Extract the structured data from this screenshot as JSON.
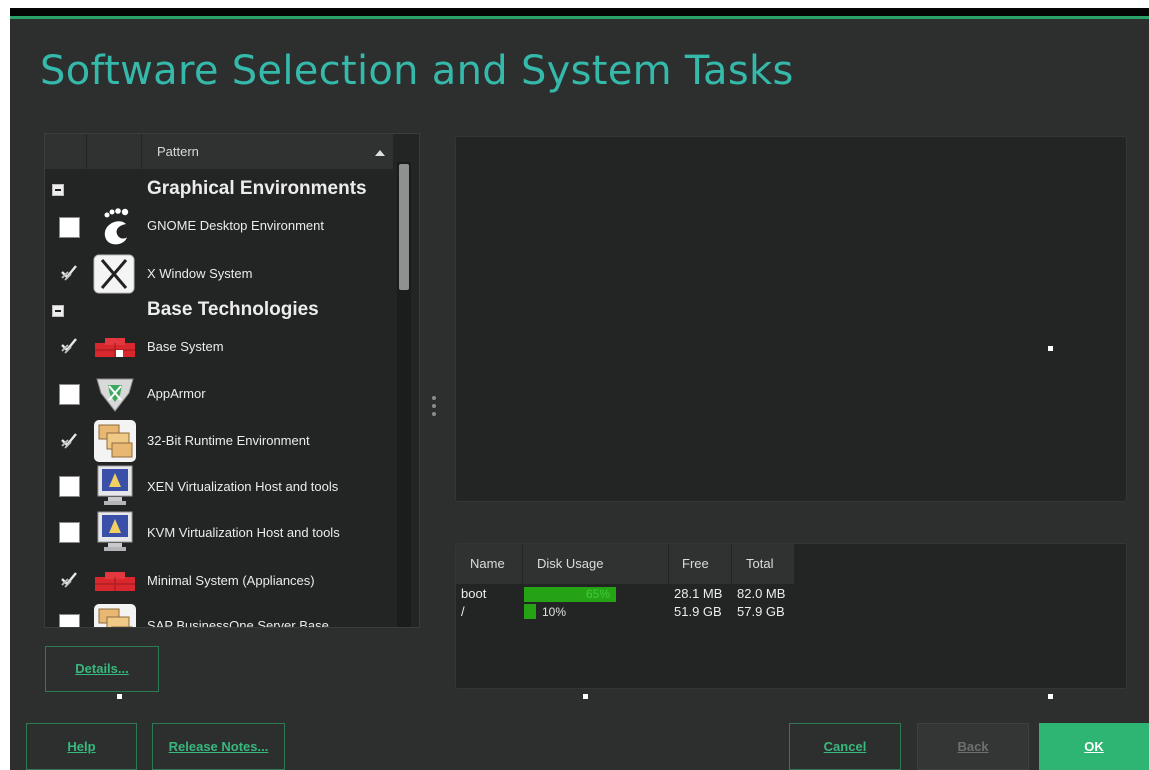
{
  "title": "Software Selection and System Tasks",
  "pattern_list": {
    "header": {
      "pattern": "Pattern"
    },
    "groups": [
      {
        "label": "Graphical Environments",
        "items": [
          {
            "label": "GNOME Desktop Environment",
            "state": "unchecked",
            "icon": "gnome-foot-icon"
          },
          {
            "label": "X Window System",
            "state": "auto-selected",
            "icon": "x-window-icon"
          }
        ]
      },
      {
        "label": "Base Technologies",
        "items": [
          {
            "label": "Base System",
            "state": "auto-selected",
            "icon": "red-bricks-icon"
          },
          {
            "label": "AppArmor",
            "state": "unchecked",
            "icon": "apparmor-shield-icon"
          },
          {
            "label": "32-Bit Runtime Environment",
            "state": "auto-selected",
            "icon": "folders-icon"
          },
          {
            "label": "XEN Virtualization Host and tools",
            "state": "unchecked",
            "icon": "monitor-icon"
          },
          {
            "label": "KVM Virtualization Host and tools",
            "state": "unchecked",
            "icon": "monitor-icon"
          },
          {
            "label": "Minimal System (Appliances)",
            "state": "auto-selected",
            "icon": "red-bricks-icon"
          },
          {
            "label": "SAP BusinessOne Server Base",
            "state": "unchecked",
            "icon": "folders-icon"
          }
        ]
      }
    ]
  },
  "disk_usage": {
    "headers": {
      "name": "Name",
      "usage": "Disk Usage",
      "free": "Free",
      "total": "Total"
    },
    "rows": [
      {
        "name": "boot",
        "usage_pct": 65,
        "usage_label": "65%",
        "free": "28.1 MB",
        "total": "82.0 MB"
      },
      {
        "name": "/",
        "usage_pct": 10,
        "usage_label": "10%",
        "free": "51.9 GB",
        "total": "57.9 GB"
      }
    ]
  },
  "buttons": {
    "details": "Details...",
    "help": "Help",
    "release_notes": "Release Notes...",
    "cancel": "Cancel",
    "back": "Back",
    "ok": "OK"
  },
  "colors": {
    "title": "#35b9ab",
    "accent": "#2fb573",
    "background": "#2c2f2e",
    "usage_bar": "#25a315"
  }
}
